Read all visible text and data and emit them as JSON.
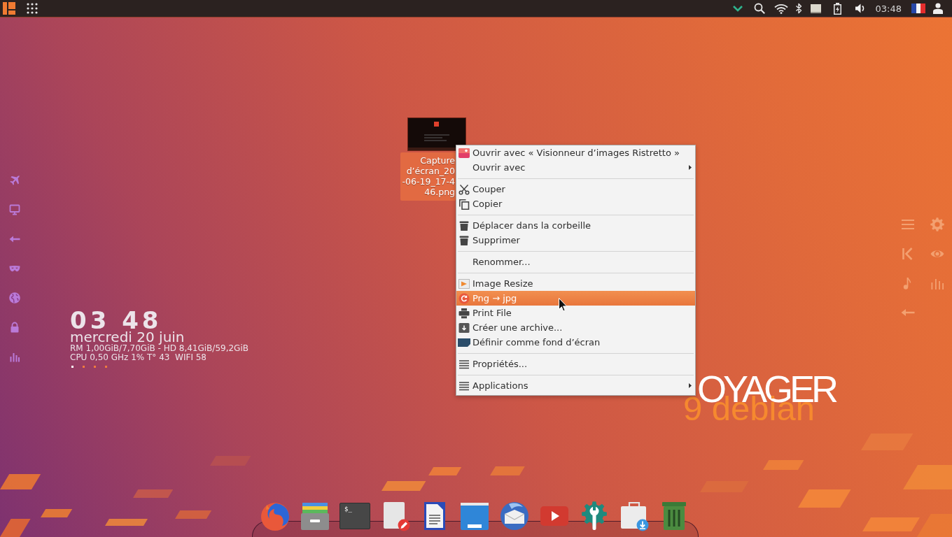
{
  "top_bar": {
    "clock": "03:48"
  },
  "desktop_file": {
    "label_lines": [
      "Capture",
      "d’écran_20",
      "-06-19_17-4",
      "46.png"
    ],
    "selected": true
  },
  "clock_widget": {
    "time": "03 48",
    "date": "mercredi 20 juin",
    "stats": [
      "RM 1,00GiB/7,70GiB - HD 8,41GiB/59,2GiB",
      "CPU 0,50 GHz 1% T° 43  WIFI 58"
    ],
    "pages": [
      {
        "selected": true
      },
      {
        "selected": false
      },
      {
        "selected": false
      },
      {
        "selected": false
      }
    ]
  },
  "context_menu": {
    "sections": [
      [
        {
          "label": "Ouvrir avec « Visionneur d’images Ristretto »",
          "selected": false,
          "submenu": false
        },
        {
          "label": "Ouvrir avec",
          "selected": false,
          "submenu": true
        }
      ],
      [
        {
          "label": "Couper",
          "selected": false,
          "submenu": false
        },
        {
          "label": "Copier",
          "selected": false,
          "submenu": false
        }
      ],
      [
        {
          "label": "Déplacer dans la corbeille",
          "selected": false,
          "submenu": false
        },
        {
          "label": "Supprimer",
          "selected": false,
          "submenu": false
        }
      ],
      [
        {
          "label": "Renommer...",
          "selected": false,
          "submenu": false
        }
      ],
      [
        {
          "label": "Image Resize",
          "selected": false,
          "submenu": false
        },
        {
          "label": "Png → jpg",
          "selected": true,
          "submenu": false
        },
        {
          "label": "Print File",
          "selected": false,
          "submenu": false
        },
        {
          "label": "Créer une archive...",
          "selected": false,
          "submenu": false
        },
        {
          "label": "Définir comme fond d’écran",
          "selected": false,
          "submenu": false
        }
      ],
      [
        {
          "label": "Propriétés...",
          "selected": false,
          "submenu": false
        }
      ],
      [
        {
          "label": "Applications",
          "selected": false,
          "submenu": true
        }
      ]
    ]
  },
  "wordmark": {
    "name": "OYAGER",
    "edition": "9 debian"
  },
  "dock": {
    "terminal_prompt": "$_"
  }
}
